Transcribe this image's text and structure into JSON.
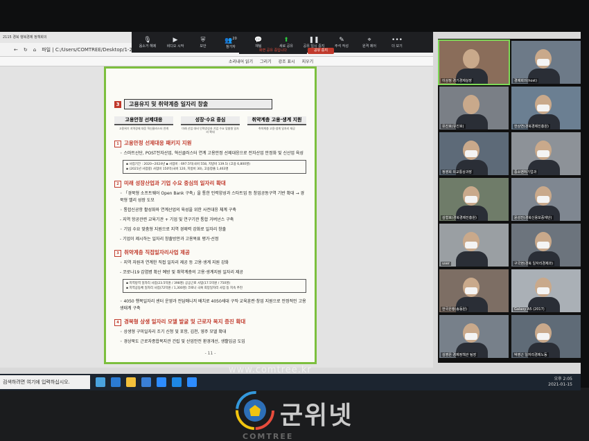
{
  "browser": {
    "tab_title": "2115 경북 행복경제 정책회의",
    "address": "파일 | C:/Users/COMTREE/Desktop/1-210115%20경북%20행복경제%20정책%20...%20(최종).pdf",
    "toolbar": [
      "소리내어 읽기",
      "그리기",
      "강조 표시",
      "지우기"
    ]
  },
  "zoom": {
    "buttons": [
      {
        "icon": "mic-muted-icon",
        "label": "음소거 해제"
      },
      {
        "icon": "video-icon",
        "label": "비디오 시작"
      },
      {
        "icon": "security-icon",
        "label": "보안"
      },
      {
        "icon": "participants-icon",
        "label": "참가자",
        "count": "20"
      },
      {
        "icon": "chat-icon",
        "label": "채팅"
      },
      {
        "icon": "share-icon",
        "label": "새로 공유"
      },
      {
        "icon": "pause-icon",
        "label": "공유 일시 중지"
      },
      {
        "icon": "annotate-icon",
        "label": "주석 작성"
      },
      {
        "icon": "remote-icon",
        "label": "원격 제어"
      },
      {
        "icon": "more-icon",
        "label": "더 보기"
      }
    ],
    "sharing_text": "화면 공유 중입니다",
    "stop_share": "공유 중지"
  },
  "doc": {
    "section_num": "3",
    "section_title": "고용유지 및 취약계층 일자리 창출",
    "heads": [
      {
        "h": "고용안정 선제대응",
        "s": "고용위기 지역경제 대응 혁신클러스터 연계"
      },
      {
        "h": "성장·수요 중심",
        "s": "미래 산업 대비 인력양성과 기업 수요 맞춤형 일자리 확대"
      },
      {
        "h": "취약계층 고용·생계 지원",
        "s": "취약계층 고용·생계 일자리 제공"
      }
    ],
    "items": [
      {
        "n": "1",
        "title": "고용안정 선제대응 패키지 지원",
        "bullets": [
          "◦ 스마트산단, POST전자산업, 혁신클러스터 연계 고용안정 선제대응으로 전자산업 안정화 및 신산업 육성"
        ],
        "box": [
          "▪ 사업기간 : 2020~2024년  ▪ 사업비 : 697.5억(국비 558, 지방비 139.5) (고용 6,800명)",
          "▪ (2021년 사업량) 사업비 150억(국비 120, 지방비 30), 고용창출 1,463명"
        ]
      },
      {
        "n": "2",
        "title": "미래 성장산업과 기업 수요 중심의 일자리 확대",
        "bullets": [
          "◦ 「경북형 소프트웨어 Open Bank 구축」을 통한 인력양성과 스타트업 등 창업공동구역 기반 확대 → 경북형 밸리 성장 도모",
          "◦ 통합신공항 활성화와 연계산업의 육성을 위한 사전대응 체계 구축",
          "  - 지역 항공관련 교육기관 + 기업 및 연구기관 통합 거버넌스 구축",
          "◦ 기업 수요 맞춤형 지원으로 지역 경제력 강화로 일자리 창출",
          "  - 기업이 제시하는 일자리 창출방안과 고용목표 평가·선정"
        ],
        "box": []
      },
      {
        "n": "3",
        "title": "취약계층 직접일자리사업 제공",
        "bullets": [
          "◦ 지역 자원과 연계한 직접 일자리 제공 등 고용·생계 지원 강화",
          "  - 코로나19 감염병 확산 예방 및 취약계층의 고용·생계지원 일자리 제공"
        ],
        "box": [
          "▪ 지역방역 일자리 사업(23.5억원 / 398명) 공공근로 사업(17.5억원 / 750명)",
          "▪ 지역공동체 일자리 사업(72억원 / 1,300명) 코로나 극복 희망일자리 사업 등 지속 추진"
        ]
      },
      {
        "n": "",
        "title": "",
        "bullets": [
          "◦ 4050 행복일자리 센터 운영과 전담매니저 배치로 4050세대 구직·교육훈련·창업 지원으로 안정적인 고용 생태계 구축"
        ],
        "box": []
      },
      {
        "n": "4",
        "title": "경북형 상생 일자리 모델 발굴 및 근로자 복지 증진 확대",
        "bullets": [
          "◦ 상생형 구미일자리 조기 신청 및 포항, 김천, 영주 모델 확대",
          "◦ 경상북도 근로자종합복지관 건립 및 산업안전 환경개선, 생활임금 도입"
        ],
        "box": []
      }
    ],
    "page_no": "- 11 -"
  },
  "participants": [
    {
      "name": "이상정 경기경제실장"
    },
    {
      "name": "경제회의(host)"
    },
    {
      "name": "유진호(유진호)"
    },
    {
      "name": "한상연(경북경제진흥원)"
    },
    {
      "name": "정영희 외교통상과장"
    },
    {
      "name": "중소벤처기업과"
    },
    {
      "name": "김형호(경북경제진흥원)"
    },
    {
      "name": "윤성진(경북신용보증재단)"
    },
    {
      "name": "user"
    },
    {
      "name": "구국현(경북 일자리경제과)"
    },
    {
      "name": "한국은행(송동원)"
    },
    {
      "name": "Galaxy A5 (2017)"
    },
    {
      "name": "김영은 경제정책관 팀장"
    },
    {
      "name": "박영근 일자리경제노동"
    }
  ],
  "taskbar": {
    "search_placeholder": "검색하려면 여기에 입력하십시오.",
    "time": "오후 2:05",
    "date": "2021-01-15"
  },
  "url_text": "www.comtree.kr",
  "watermark": {
    "text": "군위넷",
    "sub": "COMTREE"
  },
  "colors": {
    "accent_green": "#7cbf3e",
    "doc_red": "#c0392b",
    "zoom_bar": "#1e1f22"
  }
}
